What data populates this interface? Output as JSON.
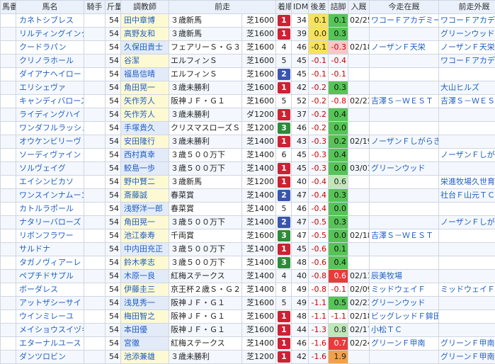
{
  "headers": {
    "umaban": "馬番",
    "name": "馬名",
    "jockey_label": "騎手",
    "weight": "斤量",
    "trainer": "調教師",
    "prev_race": "前走",
    "place": "着順",
    "idm": "IDM",
    "hc": "後差",
    "tc": "詰脚",
    "nyukyu": "入厩",
    "kyosou_in": "今走在厩",
    "kyosou_out": "前走外厩"
  },
  "rows": [
    {
      "name": "カネトシブレス",
      "weight": "54",
      "jockey": "田中章博",
      "prev_race": "３歳新馬",
      "course": "芝1600",
      "place": "1",
      "idm": "34",
      "hc": "0.1",
      "tc": "0.1",
      "date": "02/25",
      "in_stable": "ワコーＦアカデミー",
      "out_stable": "ワコーＦアカデミー"
    },
    {
      "name": "リルティングインク",
      "weight": "54",
      "jockey": "高野友和",
      "prev_race": "３歳新馬",
      "course": "芝1600",
      "place": "1",
      "idm": "39",
      "hc": "0.0",
      "tc": "0.3",
      "date": "",
      "in_stable": "",
      "out_stable": "グリーンウッド"
    },
    {
      "name": "クードラパン",
      "weight": "54",
      "jockey": "久保田貴士",
      "prev_race": "フェアリーＳ・Ｇ３",
      "course": "芝1600",
      "place": "4",
      "idm": "46",
      "hc": "-0.1",
      "tc": "-0.3",
      "date": "02/18",
      "in_stable": "ノーザンＦ天栄",
      "out_stable": "ノーザンＦ天栄"
    },
    {
      "name": "クリノラホール",
      "weight": "54",
      "jockey": "谷潔",
      "prev_race": "エルフィンＳ",
      "course": "芝1600",
      "place": "5",
      "idm": "45",
      "hc": "-0.1",
      "tc": "-0.4",
      "date": "",
      "in_stable": "",
      "out_stable": "ワコーＦアカデミー"
    },
    {
      "name": "ダイアナヘイロー",
      "weight": "54",
      "jockey": "福島信晴",
      "prev_race": "エルフィンＳ",
      "course": "芝1600",
      "place": "2",
      "idm": "45",
      "hc": "-0.1",
      "tc": "-0.1",
      "date": "",
      "in_stable": "",
      "out_stable": ""
    },
    {
      "name": "エリシェヴァ",
      "weight": "54",
      "jockey": "角田晃一",
      "prev_race": "３歳未勝利",
      "course": "芝1600",
      "place": "1",
      "idm": "42",
      "hc": "-0.2",
      "tc": "0.3",
      "date": "",
      "in_stable": "",
      "out_stable": "大山ヒルズ"
    },
    {
      "name": "キャンディバローズ",
      "weight": "54",
      "jockey": "矢作芳人",
      "prev_race": "阪神ＪＦ・Ｇ１",
      "course": "芝1600",
      "place": "5",
      "idm": "52",
      "hc": "-0.2",
      "tc": "-0.8",
      "date": "02/23",
      "in_stable": "吉澤Ｓ－ＷＥＳＴ",
      "out_stable": "吉澤Ｓ－ＷＥＳＴ"
    },
    {
      "name": "ライディングハイ",
      "weight": "54",
      "jockey": "矢作芳人",
      "prev_race": "３歳未勝利",
      "course": "ダ1200",
      "place": "1",
      "idm": "37",
      "hc": "-0.2",
      "tc": "0.4",
      "date": "",
      "in_stable": "",
      "out_stable": ""
    },
    {
      "name": "ワンダフルラッシュ",
      "weight": "54",
      "jockey": "手塚貴久",
      "prev_race": "クリスマスローズＳ",
      "course": "芝1200",
      "place": "3",
      "idm": "46",
      "hc": "-0.2",
      "tc": "0.0",
      "date": "",
      "in_stable": "",
      "out_stable": ""
    },
    {
      "name": "オウケンビリーヴ",
      "weight": "54",
      "jockey": "安田隆行",
      "prev_race": "３歳未勝利",
      "course": "芝1400",
      "place": "1",
      "idm": "43",
      "hc": "-0.3",
      "tc": "0.2",
      "date": "02/19",
      "in_stable": "ノーザンＦしがらき",
      "out_stable": ""
    },
    {
      "name": "ソーディヴァイン",
      "weight": "54",
      "jockey": "西村真幸",
      "prev_race": "３歳５００万下",
      "course": "芝1400",
      "place": "6",
      "idm": "45",
      "hc": "-0.3",
      "tc": "0.4",
      "date": "",
      "in_stable": "",
      "out_stable": "ノーザンＦしがらき"
    },
    {
      "name": "ソルヴェイグ",
      "weight": "54",
      "jockey": "鮫島一歩",
      "prev_race": "３歳５００万下",
      "course": "芝1400",
      "place": "1",
      "idm": "45",
      "hc": "-0.3",
      "tc": "0.0",
      "date": "03/01",
      "in_stable": "グリーンウッド",
      "out_stable": ""
    },
    {
      "name": "エイシンビカソ",
      "weight": "54",
      "jockey": "野中賢二",
      "prev_race": "３歳新馬",
      "course": "芝1200",
      "place": "1",
      "idm": "40",
      "hc": "-0.4",
      "tc": "0.6",
      "date": "",
      "in_stable": "",
      "out_stable": "栄進牧場久世育成Ｃ"
    },
    {
      "name": "ワンスインナムーン",
      "weight": "54",
      "jockey": "斎藤誠",
      "prev_race": "春菜賞",
      "course": "芝1400",
      "place": "2",
      "idm": "47",
      "hc": "-0.4",
      "tc": "0.3",
      "date": "",
      "in_stable": "",
      "out_stable": "社台Ｆ山元ＴＣ"
    },
    {
      "name": "カトルラポール",
      "weight": "54",
      "jockey": "浅野洋一郎",
      "prev_race": "春菜賞",
      "course": "芝1400",
      "place": "5",
      "idm": "46",
      "hc": "-0.4",
      "tc": "0.0",
      "date": "",
      "in_stable": "",
      "out_stable": ""
    },
    {
      "name": "ナタリーバローズ",
      "weight": "54",
      "jockey": "角田晃一",
      "prev_race": "３歳５００万下",
      "course": "芝1400",
      "place": "2",
      "idm": "47",
      "hc": "-0.5",
      "tc": "0.3",
      "date": "",
      "in_stable": "",
      "out_stable": "ノーザンＦしがらき"
    },
    {
      "name": "リボンフラワー",
      "weight": "54",
      "jockey": "池江泰寿",
      "prev_race": "千両賞",
      "course": "芝1600",
      "place": "3",
      "idm": "47",
      "hc": "-0.5",
      "tc": "0.0",
      "date": "02/18",
      "in_stable": "吉澤Ｓ－ＷＥＳＴ",
      "out_stable": ""
    },
    {
      "name": "サルドナ",
      "weight": "54",
      "jockey": "中内田充正",
      "prev_race": "３歳５００万下",
      "course": "芝1400",
      "place": "1",
      "idm": "45",
      "hc": "-0.6",
      "tc": "0.1",
      "date": "",
      "in_stable": "",
      "out_stable": ""
    },
    {
      "name": "タガノヴィアーレ",
      "weight": "54",
      "jockey": "鈴木孝志",
      "prev_race": "３歳５００万下",
      "course": "芝1400",
      "place": "3",
      "idm": "48",
      "hc": "-0.6",
      "tc": "0.4",
      "date": "",
      "in_stable": "",
      "out_stable": ""
    },
    {
      "name": "ペプチドサプル",
      "weight": "54",
      "jockey": "木原一良",
      "prev_race": "紅梅ステークス",
      "course": "芝1400",
      "place": "4",
      "idm": "40",
      "hc": "-0.8",
      "tc": "0.6",
      "date": "02/11",
      "in_stable": "辰美牧場",
      "out_stable": ""
    },
    {
      "name": "ボーダレス",
      "weight": "54",
      "jockey": "伊藤圭三",
      "prev_race": "京王杯２歳Ｓ・Ｇ２",
      "course": "芝1400",
      "place": "8",
      "idm": "49",
      "hc": "-0.8",
      "tc": "-0.1",
      "date": "02/09",
      "in_stable": "ミッドウェイＦ",
      "out_stable": "ミッドウェイＦ"
    },
    {
      "name": "アットザシーサイド",
      "weight": "54",
      "jockey": "浅見秀一",
      "prev_race": "阪神ＪＦ・Ｇ１",
      "course": "芝1600",
      "place": "5",
      "idm": "49",
      "hc": "-1.1",
      "tc": "0.5",
      "date": "02/23",
      "in_stable": "グリーンウッド",
      "out_stable": ""
    },
    {
      "name": "ウインミレーユ",
      "weight": "54",
      "jockey": "梅田智之",
      "prev_race": "阪神ＪＦ・Ｇ１",
      "course": "芝1600",
      "place": "1",
      "idm": "48",
      "hc": "-1.1",
      "tc": "-1.1",
      "date": "02/18",
      "in_stable": "ビッグレッドＦ鉾田",
      "out_stable": ""
    },
    {
      "name": "メイショウスイヅキ",
      "weight": "54",
      "jockey": "本田優",
      "prev_race": "阪神ＪＦ・Ｇ１",
      "course": "芝1600",
      "place": "1",
      "idm": "44",
      "hc": "-1.3",
      "tc": "0.8",
      "date": "02/17",
      "in_stable": "小松ＴＣ",
      "out_stable": ""
    },
    {
      "name": "エターナルユース",
      "weight": "54",
      "jockey": "宮徹",
      "prev_race": "紅梅ステークス",
      "course": "芝1400",
      "place": "1",
      "idm": "46",
      "hc": "-1.6",
      "tc": "0.7",
      "date": "02/24",
      "in_stable": "グリーンＦ甲南",
      "out_stable": "グリーンＦ甲南"
    },
    {
      "name": "ダンツロビン",
      "weight": "54",
      "jockey": "池添兼雄",
      "prev_race": "３歳未勝利",
      "course": "芝1200",
      "place": "1",
      "idm": "42",
      "hc": "-1.6",
      "tc": "1.9",
      "date": "",
      "in_stable": "",
      "out_stable": "グリーンＦ甲南"
    }
  ],
  "row_styles": [
    {
      "pl": "p1",
      "hc": "y",
      "tc": "g",
      "jk": "t1"
    },
    {
      "pl": "p1",
      "hc": "y",
      "tc": "g",
      "jk": "t1"
    },
    {
      "pl": "",
      "hc": "y",
      "tc": "pk",
      "jk": "t2"
    },
    {
      "pl": "",
      "hc": "neg",
      "tc": "neg",
      "jk": "t1"
    },
    {
      "pl": "p2",
      "hc": "neg",
      "tc": "neg",
      "jk": "t2"
    },
    {
      "pl": "p1",
      "hc": "neg",
      "tc": "g",
      "jk": "t1"
    },
    {
      "pl": "",
      "hc": "neg",
      "tc": "neg",
      "jk": "t1"
    },
    {
      "pl": "p1",
      "hc": "neg",
      "tc": "g",
      "jk": "t1"
    },
    {
      "pl": "p3",
      "hc": "neg",
      "tc": "g",
      "jk": "t2"
    },
    {
      "pl": "p1",
      "hc": "neg",
      "tc": "g",
      "jk": "t1"
    },
    {
      "pl": "",
      "hc": "neg",
      "tc": "g",
      "jk": "t2"
    },
    {
      "pl": "p1",
      "hc": "neg",
      "tc": "g",
      "jk": "t2"
    },
    {
      "pl": "p1",
      "hc": "neg",
      "tc": "lg",
      "jk": "t1"
    },
    {
      "pl": "p2",
      "hc": "neg",
      "tc": "g",
      "jk": "t1"
    },
    {
      "pl": "",
      "hc": "neg",
      "tc": "g",
      "jk": "t2"
    },
    {
      "pl": "p2",
      "hc": "neg",
      "tc": "g",
      "jk": "t1"
    },
    {
      "pl": "p3",
      "hc": "neg",
      "tc": "g",
      "jk": "t1"
    },
    {
      "pl": "p1",
      "hc": "neg",
      "tc": "g",
      "jk": "t2"
    },
    {
      "pl": "p3",
      "hc": "neg",
      "tc": "g",
      "jk": "t1"
    },
    {
      "pl": "",
      "hc": "neg",
      "tc": "r",
      "jk": "t2"
    },
    {
      "pl": "",
      "hc": "neg",
      "tc": "neg",
      "jk": "t1"
    },
    {
      "pl": "",
      "hc": "neg",
      "tc": "g",
      "jk": "t2"
    },
    {
      "pl": "p1",
      "hc": "neg",
      "tc": "neg",
      "jk": "t1"
    },
    {
      "pl": "p1",
      "hc": "neg",
      "tc": "lg",
      "jk": "t2"
    },
    {
      "pl": "p1",
      "hc": "neg",
      "tc": "r",
      "jk": "t2"
    },
    {
      "pl": "p1",
      "hc": "neg",
      "tc": "o",
      "jk": "t1"
    }
  ]
}
